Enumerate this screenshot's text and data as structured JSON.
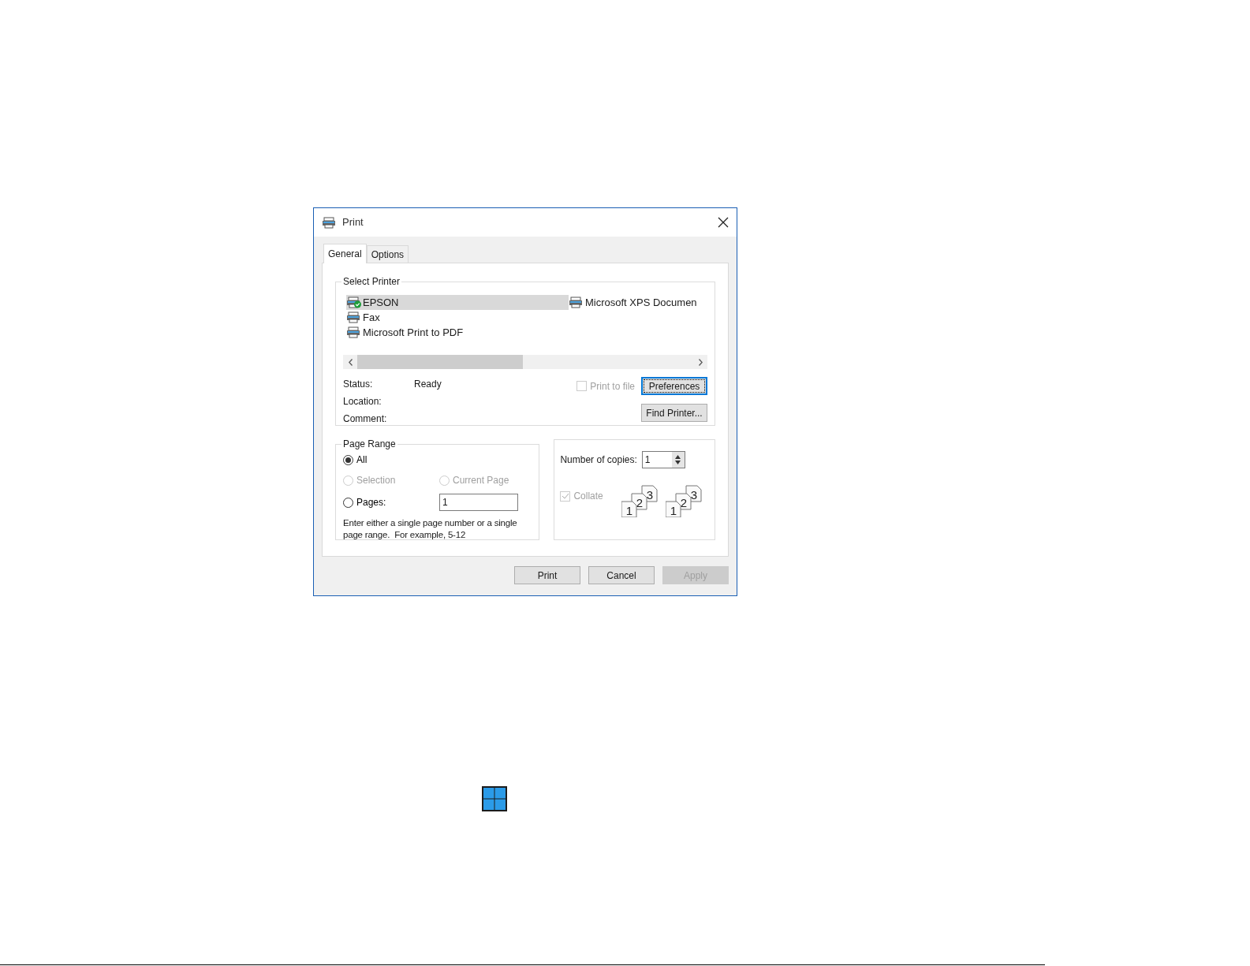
{
  "window": {
    "title": "Print"
  },
  "tabs": [
    {
      "label": "General",
      "selected": true
    },
    {
      "label": "Options",
      "selected": false
    }
  ],
  "select_printer": {
    "title": "Select Printer",
    "printers": [
      {
        "name": "EPSON",
        "selected": true,
        "default": true
      },
      {
        "name": "Fax",
        "selected": false,
        "default": false
      },
      {
        "name": "Microsoft Print to PDF",
        "selected": false,
        "default": false
      },
      {
        "name": "Microsoft XPS Documen",
        "selected": false,
        "default": false
      }
    ],
    "status_label": "Status:",
    "status_value": "Ready",
    "location_label": "Location:",
    "comment_label": "Comment:",
    "print_to_file": {
      "label": "Print to file",
      "checked": false,
      "disabled": true
    },
    "preferences_button": "Preferences",
    "find_printer_button": "Find Printer..."
  },
  "page_range": {
    "title": "Page Range",
    "options": [
      {
        "label": "All",
        "selected": true,
        "disabled": false
      },
      {
        "label": "Selection",
        "selected": false,
        "disabled": true
      },
      {
        "label": "Current Page",
        "selected": false,
        "disabled": true
      },
      {
        "label": "Pages:",
        "selected": false,
        "disabled": false
      }
    ],
    "pages_value": "1",
    "hint": "Enter either a single page number or a single page range.  For example, 5-12"
  },
  "copies": {
    "label": "Number of copies:",
    "value": "1",
    "collate": {
      "label": "Collate",
      "checked": true,
      "disabled": true
    },
    "stacks": [
      {
        "labels": [
          "1",
          "2",
          "3"
        ]
      },
      {
        "labels": [
          "1",
          "2",
          "3"
        ]
      }
    ]
  },
  "buttons": [
    {
      "label": "Print",
      "disabled": false
    },
    {
      "label": "Cancel",
      "disabled": false
    },
    {
      "label": "Apply",
      "disabled": true
    }
  ]
}
